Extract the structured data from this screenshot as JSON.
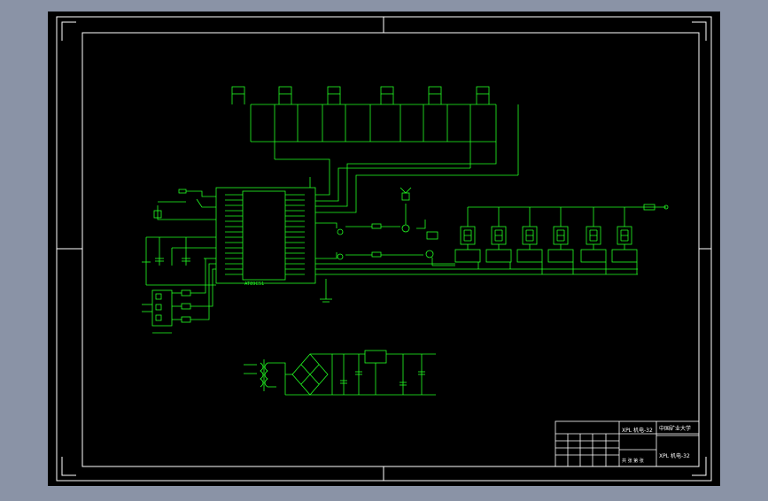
{
  "colors": {
    "viewport_bg": "#8a93a6",
    "sheet_bg": "#000000",
    "frame": "#ffffff",
    "wire": "#22ff22"
  },
  "title_block": {
    "org": "中国矿业大学",
    "code_top": "XPL 机电-32",
    "code_bottom": "XPL 机电-32",
    "sheet": "共 张 第 张"
  },
  "labels": {
    "mcu_part": "AT89C51"
  }
}
